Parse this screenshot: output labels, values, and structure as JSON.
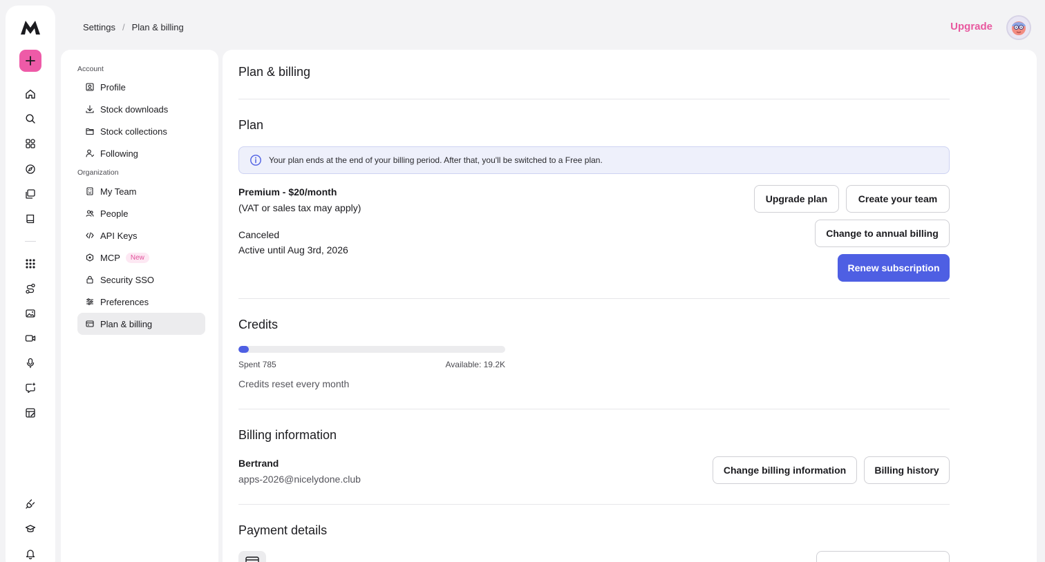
{
  "breadcrumb": {
    "root": "Settings",
    "separator": "/",
    "current": "Plan & billing"
  },
  "header": {
    "upgrade_label": "Upgrade"
  },
  "rail": {
    "icons": [
      "home-icon",
      "search-icon",
      "apps-grid-icon",
      "compass-icon",
      "library-icon",
      "book-icon",
      "dots-grid-icon",
      "workflow-icon",
      "image-icon",
      "video-icon",
      "microphone-icon",
      "chat-spark-icon",
      "edit-board-icon",
      "plug-icon",
      "graduation-icon",
      "bell-icon"
    ]
  },
  "nav": {
    "account_label": "Account",
    "organization_label": "Organization",
    "items": [
      {
        "label": "Profile"
      },
      {
        "label": "Stock downloads"
      },
      {
        "label": "Stock collections"
      },
      {
        "label": "Following"
      },
      {
        "label": "My Team"
      },
      {
        "label": "People"
      },
      {
        "label": "API Keys"
      },
      {
        "label": "MCP",
        "badge": "New"
      },
      {
        "label": "Security SSO"
      },
      {
        "label": "Preferences"
      },
      {
        "label": "Plan & billing",
        "active": true
      }
    ]
  },
  "main": {
    "title": "Plan & billing",
    "plan": {
      "heading": "Plan",
      "notice": "Your plan ends at the end of your billing period. After that, you'll be switched to a Free plan.",
      "name": "Premium - $20/month",
      "tax_note": "(VAT or sales tax may apply)",
      "status": "Canceled",
      "active_until": "Active until Aug 3rd, 2026",
      "buttons": {
        "upgrade": "Upgrade plan",
        "create_team": "Create your team",
        "annual": "Change to annual billing",
        "renew": "Renew subscription"
      }
    },
    "credits": {
      "heading": "Credits",
      "spent_label": "Spent 785",
      "available_label": "Available: 19.2K",
      "spent": 785,
      "available": 19200,
      "reset_note": "Credits reset every month"
    },
    "billing": {
      "heading": "Billing information",
      "name": "Bertrand",
      "email": "apps-2026@nicelydone.club",
      "buttons": {
        "change": "Change billing information",
        "history": "Billing history"
      }
    },
    "payment": {
      "heading": "Payment details"
    }
  },
  "colors": {
    "accent": "#4e5fe3",
    "brand_pink": "#ee5aa7",
    "upgrade_pink": "#e8589f"
  }
}
